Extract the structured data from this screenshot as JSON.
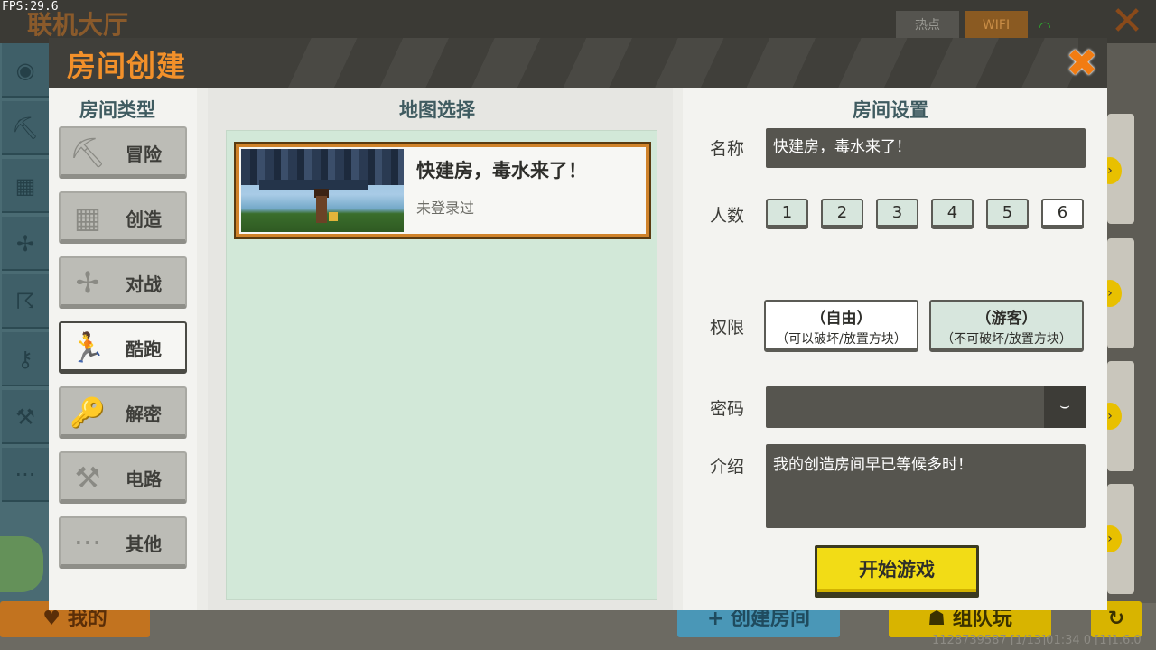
{
  "lobby": {
    "fps": "FPS:29.6",
    "title": "联机大厅",
    "network_tabs": [
      "热点",
      "WIFI"
    ],
    "bottom_buttons": {
      "my": "我的",
      "create_room": "创建房间",
      "team_play": "组队玩"
    },
    "footer": "1128739587   [1/13]01:34 0  [1]1.6.0"
  },
  "dialog": {
    "title": "房间创建",
    "room_type": {
      "header": "房间类型",
      "items": [
        {
          "label": "冒险",
          "icon": "pickaxe-icon",
          "glyph": "⛏"
        },
        {
          "label": "创造",
          "icon": "block-icon",
          "glyph": "▦"
        },
        {
          "label": "对战",
          "icon": "crossbow-icon",
          "glyph": "✢"
        },
        {
          "label": "酷跑",
          "icon": "runner-icon",
          "glyph": "🏃"
        },
        {
          "label": "解密",
          "icon": "key-icon",
          "glyph": "🔑"
        },
        {
          "label": "电路",
          "icon": "tools-icon",
          "glyph": "⚒"
        },
        {
          "label": "其他",
          "icon": "more-icon",
          "glyph": "···"
        }
      ],
      "selected": "酷跑"
    },
    "map_select": {
      "header": "地图选择",
      "map": {
        "name": "快建房，毒水来了！",
        "status": "未登录过"
      }
    },
    "room_settings": {
      "header": "房间设置",
      "name_label": "名称",
      "name_value": "快建房，毒水来了！",
      "count_label": "人数",
      "counts": [
        "1",
        "2",
        "3",
        "4",
        "5",
        "6"
      ],
      "selected_count": "6",
      "permission_label": "权限",
      "permission_free": {
        "title": "（自由）",
        "desc": "（可以破坏/放置方块）"
      },
      "permission_guest": {
        "title": "（游客）",
        "desc": "（不可破坏/放置方块）"
      },
      "password_label": "密码",
      "password_value": "",
      "intro_label": "介绍",
      "intro_value": "我的创造房间早已等候多时！",
      "start_button": "开始游戏"
    }
  }
}
